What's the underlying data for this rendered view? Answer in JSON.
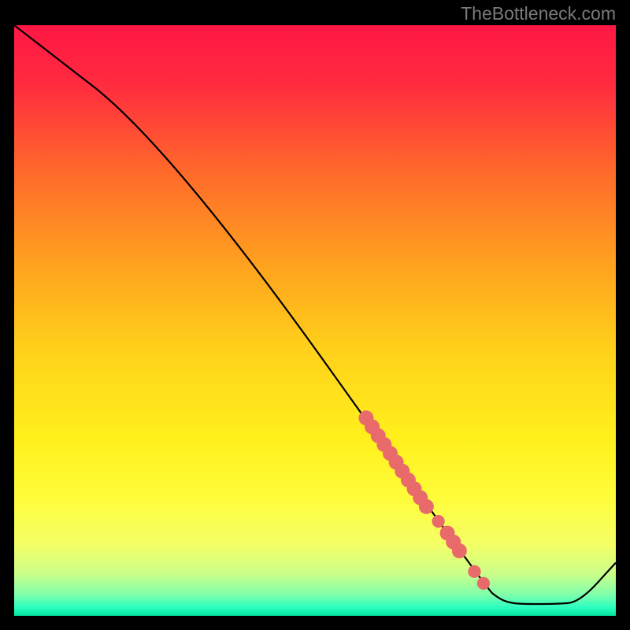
{
  "watermark": "TheBottleneck.com",
  "chart_data": {
    "type": "line",
    "title": "",
    "xlabel": "",
    "ylabel": "",
    "xlim": [
      0,
      100
    ],
    "ylim": [
      0,
      100
    ],
    "gradient_stops": [
      {
        "offset": 0.0,
        "color": "#ff1744"
      },
      {
        "offset": 0.1,
        "color": "#ff2b3f"
      },
      {
        "offset": 0.25,
        "color": "#ff6a2a"
      },
      {
        "offset": 0.4,
        "color": "#ffa01f"
      },
      {
        "offset": 0.55,
        "color": "#ffd11a"
      },
      {
        "offset": 0.7,
        "color": "#fff01c"
      },
      {
        "offset": 0.8,
        "color": "#fffd3a"
      },
      {
        "offset": 0.88,
        "color": "#f4ff67"
      },
      {
        "offset": 0.93,
        "color": "#c9ff8a"
      },
      {
        "offset": 0.965,
        "color": "#7dffac"
      },
      {
        "offset": 0.985,
        "color": "#2effc0"
      },
      {
        "offset": 1.0,
        "color": "#00e5a0"
      }
    ],
    "curve": {
      "x": [
        0,
        26,
        78.5,
        80.5,
        82,
        84,
        90,
        94,
        100
      ],
      "y": [
        100,
        79.5,
        4.6,
        3.0,
        2.3,
        2.0,
        2.0,
        2.3,
        9.0
      ]
    },
    "markers": [
      {
        "x": 58.5,
        "y": 33.5,
        "r": 1.2
      },
      {
        "x": 59.5,
        "y": 32.0,
        "r": 1.2
      },
      {
        "x": 60.5,
        "y": 30.5,
        "r": 1.2
      },
      {
        "x": 61.5,
        "y": 29.0,
        "r": 1.2
      },
      {
        "x": 62.5,
        "y": 27.5,
        "r": 1.2
      },
      {
        "x": 63.5,
        "y": 26.0,
        "r": 1.2
      },
      {
        "x": 64.5,
        "y": 24.5,
        "r": 1.2
      },
      {
        "x": 65.5,
        "y": 23.0,
        "r": 1.2
      },
      {
        "x": 66.5,
        "y": 21.5,
        "r": 1.2
      },
      {
        "x": 67.5,
        "y": 20.0,
        "r": 1.2
      },
      {
        "x": 68.5,
        "y": 18.5,
        "r": 1.2
      },
      {
        "x": 70.5,
        "y": 16.0,
        "r": 0.9
      },
      {
        "x": 72.0,
        "y": 14.0,
        "r": 1.2
      },
      {
        "x": 73.0,
        "y": 12.5,
        "r": 1.2
      },
      {
        "x": 74.0,
        "y": 11.0,
        "r": 1.2
      },
      {
        "x": 76.5,
        "y": 7.5,
        "r": 0.9
      },
      {
        "x": 78.0,
        "y": 5.5,
        "r": 0.9
      }
    ],
    "marker_color": "#e96a6a"
  }
}
